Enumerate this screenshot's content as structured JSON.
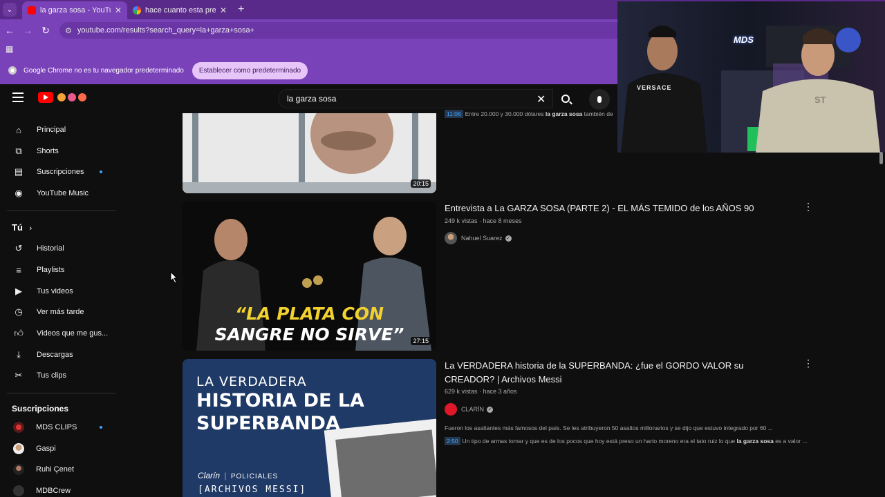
{
  "browser": {
    "tabs": [
      {
        "title": "la garza sosa - YouTube",
        "favicon": "youtube-favicon",
        "active": true
      },
      {
        "title": "hace cuanto esta preso robledo",
        "favicon": "google-favicon",
        "active": false
      }
    ],
    "url": "youtube.com/results?search_query=la+garza+sosa+",
    "infobar": {
      "message": "Google Chrome no es tu navegador predeterminado",
      "button": "Establecer como predeterminado"
    }
  },
  "youtube": {
    "search_value": "la garza sosa",
    "sidebar": {
      "main": [
        {
          "label": "Principal",
          "icon": "home-icon"
        },
        {
          "label": "Shorts",
          "icon": "shorts-icon"
        },
        {
          "label": "Suscripciones",
          "icon": "subscriptions-icon",
          "dot": true
        },
        {
          "label": "YouTube Music",
          "icon": "music-icon"
        }
      ],
      "you_heading": "Tú",
      "you": [
        {
          "label": "Historial",
          "icon": "history-icon"
        },
        {
          "label": "Playlists",
          "icon": "playlists-icon"
        },
        {
          "label": "Tus videos",
          "icon": "your-videos-icon"
        },
        {
          "label": "Ver más tarde",
          "icon": "watch-later-icon"
        },
        {
          "label": "Videos que me gus...",
          "icon": "like-icon"
        },
        {
          "label": "Descargas",
          "icon": "download-icon"
        },
        {
          "label": "Tus clips",
          "icon": "clips-icon"
        }
      ],
      "subs_heading": "Suscripciones",
      "subs": [
        {
          "label": "MDS CLIPS",
          "dot": true
        },
        {
          "label": "Gaspi"
        },
        {
          "label": "Ruhi Çenet"
        },
        {
          "label": "MDBCrew"
        }
      ]
    },
    "results": [
      {
        "duration": "20:15",
        "snippet_ts": "11:06",
        "snippet_pre": "Entre 20.000 y 30.000 dólares ",
        "snippet_bold": "la garza sosa",
        "snippet_post": " también de"
      },
      {
        "title": "Entrevista a La GARZA SOSA (PARTE 2) - EL MÁS TEMIDO de los AÑOS 90",
        "meta": "249 k vistas · hace 8 meses",
        "channel": "Nahuel Suarez",
        "duration": "27:15",
        "thumb_text_1": "“LA PLATA CON",
        "thumb_text_2": "SANGRE NO SIRVE”"
      },
      {
        "title": "La VERDADERA historia de la SUPERBANDA: ¿fue el GORDO VALOR su CREADOR? | Archivos Messi",
        "meta": "629 k vistas · hace 3 años",
        "channel": "CLARÍN",
        "description": "Fueron los asaltantes más famosos del país. Se les atribuyeron 50 asaltos millonarios y se dijo que estuvo integrado por 60 ...",
        "snippet_ts": "2:50",
        "snippet_pre": "Un tipo de armas tomar y que es de los pocos que hoy está preso un harto moreno era el tato ruiz lo que ",
        "snippet_bold": "la garza sosa",
        "snippet_post": " es a valor ...",
        "thumb_text_1": "LA VERDADERA",
        "thumb_text_2": "HISTORIA DE LA",
        "thumb_text_3": "SUPERBANDA",
        "thumb_brand": "Clarín",
        "thumb_section": "POLICIALES",
        "thumb_series": "[ARCHIVOS MESSI]"
      }
    ]
  },
  "overlay": {
    "neon_sign": "MDS",
    "shirt_1": "VERSACE",
    "shirt_2": "ST"
  }
}
